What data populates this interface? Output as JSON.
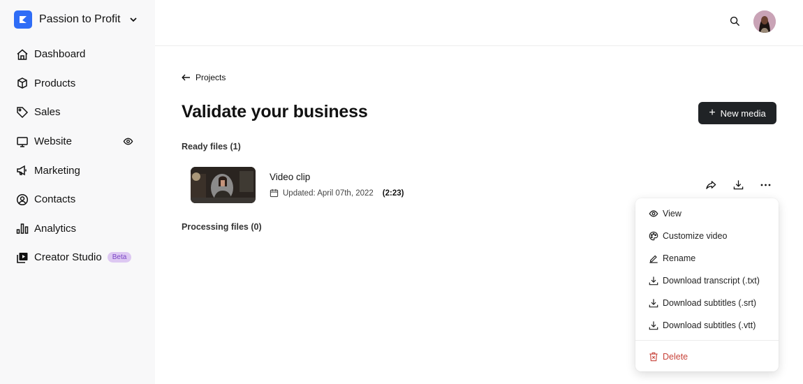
{
  "sidebar": {
    "brand": {
      "name": "Passion to Profit",
      "color": "#2f6df6"
    },
    "items": [
      {
        "label": "Dashboard",
        "icon": "home-icon"
      },
      {
        "label": "Products",
        "icon": "box-icon"
      },
      {
        "label": "Sales",
        "icon": "tag-icon"
      },
      {
        "label": "Website",
        "icon": "monitor-icon",
        "right_icon": "eye-icon"
      },
      {
        "label": "Marketing",
        "icon": "megaphone-icon"
      },
      {
        "label": "Contacts",
        "icon": "user-circle-icon"
      },
      {
        "label": "Analytics",
        "icon": "bar-chart-icon"
      },
      {
        "label": "Creator Studio",
        "icon": "video-library-icon",
        "badge": "Beta"
      }
    ]
  },
  "header": {
    "search_icon": "search-icon",
    "avatar": "user-avatar"
  },
  "main": {
    "back_label": "Projects",
    "title": "Validate your business",
    "new_media_label": "New media",
    "ready_label": "Ready files (1)",
    "processing_label": "Processing files (0)",
    "files": [
      {
        "name": "Video clip",
        "updated": "Updated: April 07th, 2022",
        "duration": "(2:23)"
      }
    ]
  },
  "menu": {
    "items": [
      {
        "label": "View",
        "icon": "eye-icon"
      },
      {
        "label": "Customize video",
        "icon": "palette-icon"
      },
      {
        "label": "Rename",
        "icon": "pencil-icon"
      },
      {
        "label": "Download transcript (.txt)",
        "icon": "download-icon"
      },
      {
        "label": "Download subtitles (.srt)",
        "icon": "download-icon"
      },
      {
        "label": "Download subtitles (.vtt)",
        "icon": "download-icon"
      }
    ],
    "delete_label": "Delete",
    "danger_color": "#c8433a"
  }
}
